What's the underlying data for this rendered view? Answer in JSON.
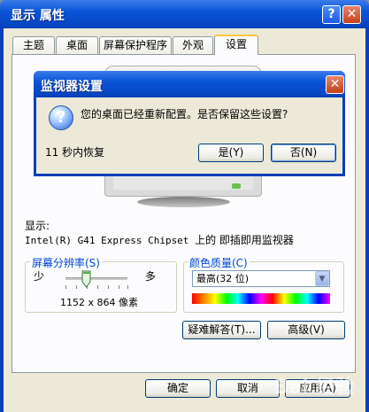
{
  "main_window": {
    "title": "显示 属性",
    "help_glyph": "?",
    "close_glyph": "✕"
  },
  "tabs": [
    {
      "label": "主题"
    },
    {
      "label": "桌面"
    },
    {
      "label": "屏幕保护程序"
    },
    {
      "label": "外观"
    },
    {
      "label": "设置",
      "active": true
    }
  ],
  "display": {
    "label": "显示:",
    "device_prefix": "Intel(R) G41 Express Chipset",
    "device_suffix": "上的 即插即用监视器"
  },
  "resolution": {
    "title": "屏幕分辨率(S)",
    "less": "少",
    "more": "多",
    "value_text": "1152 x 864 像素",
    "slider_level": 0.33
  },
  "color_quality": {
    "title": "颜色质量(C)",
    "selected": "最高(32 位)"
  },
  "buttons": {
    "troubleshoot": "疑难解答(T)...",
    "advanced": "高级(V)",
    "ok": "确定",
    "cancel": "取消",
    "apply": "应用(A)"
  },
  "watermark": "Bai 经验",
  "dialog": {
    "title": "监视器设置",
    "message": "您的桌面已经重新配置。是否保留这些设置?",
    "countdown": "11 秒内恢复",
    "yes": "是(Y)",
    "no": "否(N)",
    "icon": "question-icon",
    "icon_glyph": "?"
  },
  "colors": {
    "titlebar": "#0a55d8",
    "window_bg": "#ece9d8",
    "group_title": "#0046d5"
  }
}
